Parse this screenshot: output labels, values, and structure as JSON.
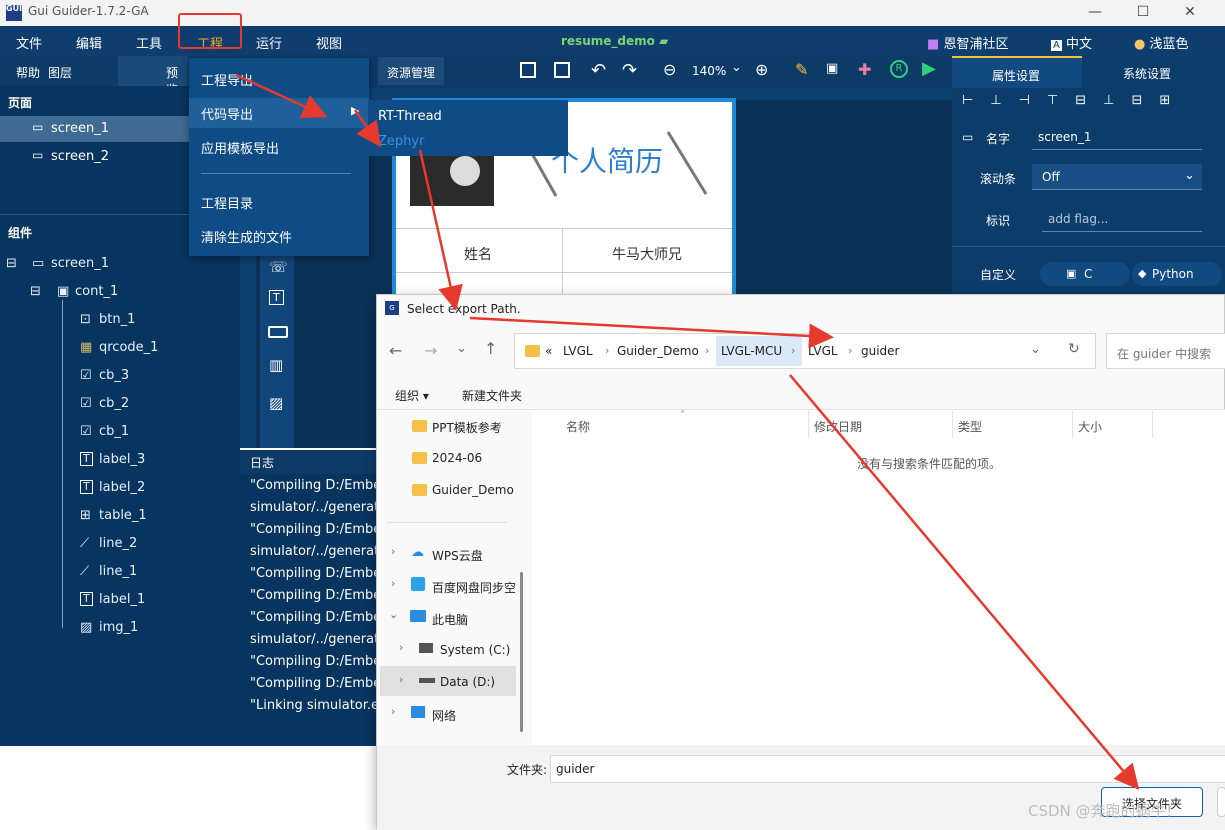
{
  "window": {
    "title": "Gui Guider-1.7.2-GA",
    "minimize": "—",
    "maximize": "☐",
    "close": "✕"
  },
  "menubar": {
    "items": [
      "文件",
      "编辑",
      "工具",
      "工程",
      "运行",
      "视图"
    ],
    "project": "resume_demo",
    "right": [
      "恩智浦社区",
      "中文",
      "浅蓝色"
    ]
  },
  "left_tabs": {
    "help": "帮助",
    "layer": "图层",
    "preview": "预览"
  },
  "resource_tab": "资源管理",
  "zoom": "140%",
  "pages": {
    "title": "页面",
    "items": [
      "screen_1",
      "screen_2"
    ]
  },
  "components": {
    "title": "组件",
    "root": "screen_1",
    "cont": "cont_1",
    "items": [
      "btn_1",
      "qrcode_1",
      "cb_3",
      "cb_2",
      "cb_1",
      "label_3",
      "label_2",
      "table_1",
      "line_2",
      "line_1",
      "label_1",
      "img_1"
    ]
  },
  "dropdown": {
    "items": [
      "工程导出",
      "代码导出",
      "应用模板导出",
      "工程目录",
      "清除生成的文件"
    ],
    "submenu": [
      "RT-Thread",
      "Zephyr"
    ]
  },
  "canvas": {
    "title": "个人简历",
    "name_label": "姓名",
    "name_value": "牛马大师兄"
  },
  "log": {
    "title": "日志",
    "lines": [
      "\"Compiling D:/Embe",
      "simulator/../generate",
      "\"Compiling D:/Embe",
      "simulator/../generate",
      "\"Compiling D:/Embe",
      "\"Compiling D:/Embe",
      "\"Compiling D:/Embe",
      "simulator/../generate",
      "\"Compiling D:/Embe",
      "\"Compiling D:/Embe",
      "\"Linking simulator.ex"
    ]
  },
  "right_panel": {
    "tabs": [
      "属性设置",
      "系统设置"
    ],
    "name_label": "名字",
    "name_value": "screen_1",
    "scroll_label": "滚动条",
    "scroll_value": "Off",
    "flag_label": "标识",
    "flag_placeholder": "add flag...",
    "custom_label": "自定义",
    "custom_c": "C",
    "custom_python": "Python"
  },
  "dialog": {
    "title": "Select export Path.",
    "breadcrumb": [
      "«",
      "LVGL",
      "Guider_Demo",
      "LVGL-MCU",
      "LVGL",
      "guider"
    ],
    "search_placeholder": "在 guider 中搜索",
    "organize": "组织",
    "new_folder": "新建文件夹",
    "nav": [
      "PPT模板参考",
      "2024-06",
      "Guider_Demo",
      "WPS云盘",
      "百度网盘同步空",
      "此电脑",
      "System (C:)",
      "Data (D:)",
      "网络"
    ],
    "columns": [
      "名称",
      "修改日期",
      "类型",
      "大小"
    ],
    "empty_msg": "没有与搜索条件匹配的项。",
    "folder_label": "文件夹:",
    "folder_value": "guider",
    "select_button": "选择文件夹"
  },
  "watermark": "CSDN @奔跑的蜗牛！",
  "colors": {
    "accent_red": "#e53a2d",
    "panel_bg": "#07355f",
    "menu_bg": "#0f4c86"
  }
}
